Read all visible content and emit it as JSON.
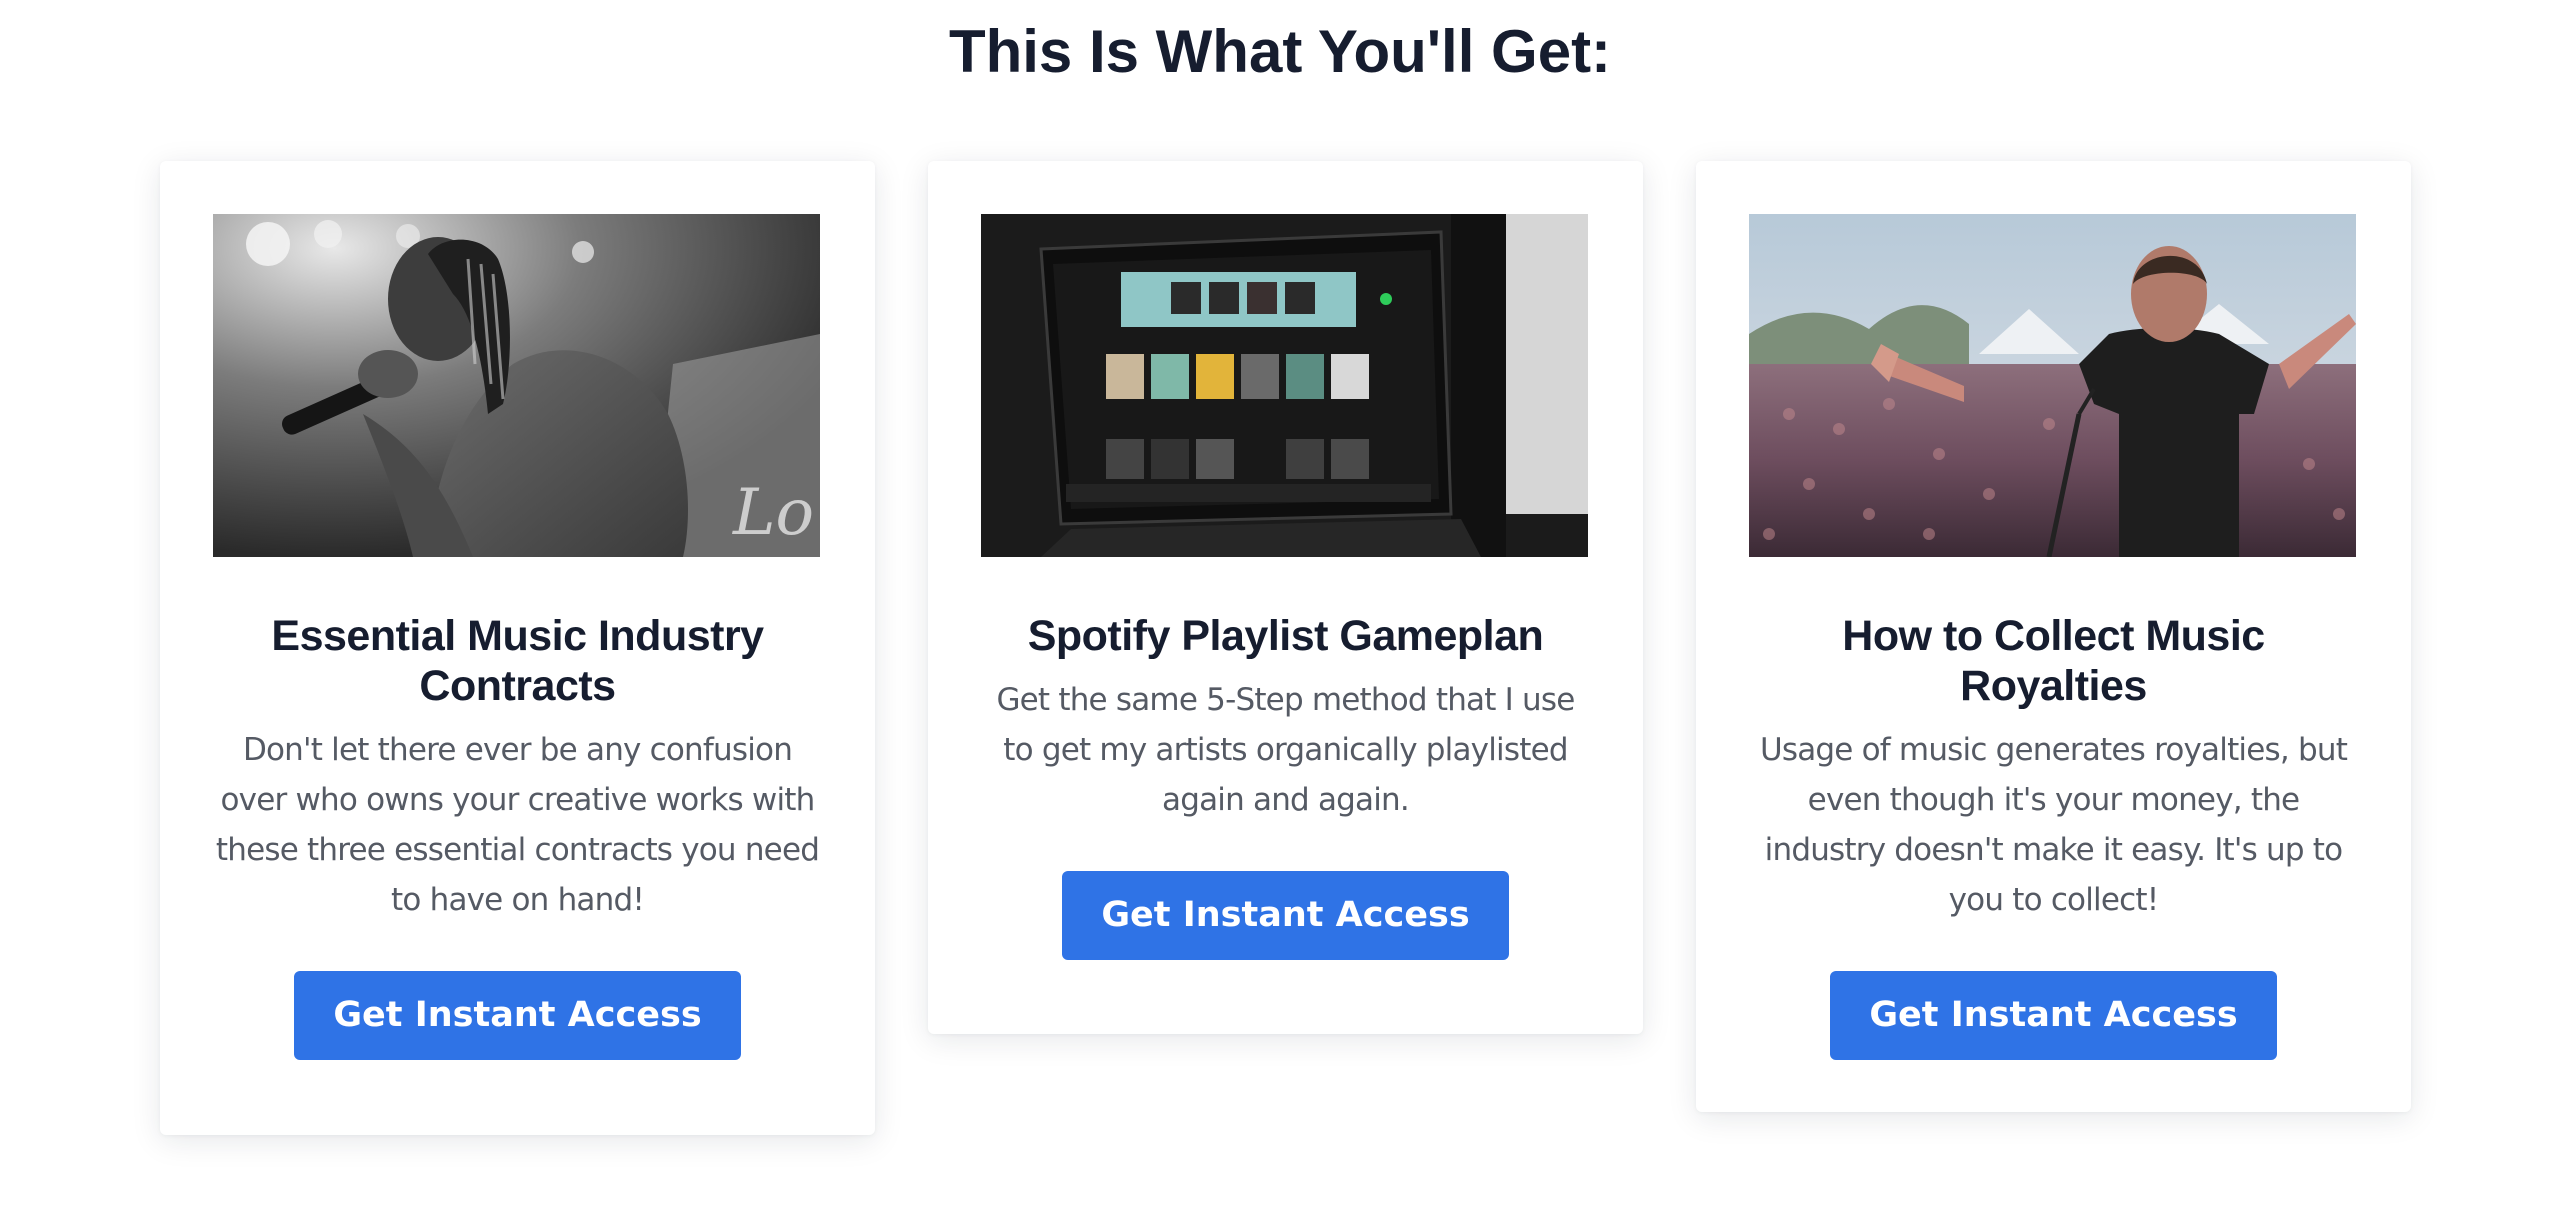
{
  "page_title": "This Is What You'll Get:",
  "colors": {
    "heading": "#161d2f",
    "body_text": "#555a64",
    "button_bg": "#2f73e6",
    "button_text": "#ffffff",
    "card_bg": "#ffffff"
  },
  "cards": [
    {
      "image": "rapper-singing-into-microphone-photo",
      "title": "Essential Music Industry Contracts",
      "description": "Don't let there ever be any confusion over who owns your creative works with these three essential contracts you need to have on hand!",
      "button_label": "Get Instant Access"
    },
    {
      "image": "laptop-showing-spotify-playlists-photo",
      "title": "Spotify Playlist Gameplan",
      "description": "Get the same 5-Step method that I use to get my artists organically playlisted again and again.",
      "button_label": "Get Instant Access"
    },
    {
      "image": "performer-facing-festival-crowd-photo",
      "title": "How to Collect Music Royalties",
      "description": "Usage of music generates royalties, but even though it's your money, the industry doesn't make it easy. It's up to you to collect!",
      "button_label": "Get Instant Access"
    }
  ]
}
